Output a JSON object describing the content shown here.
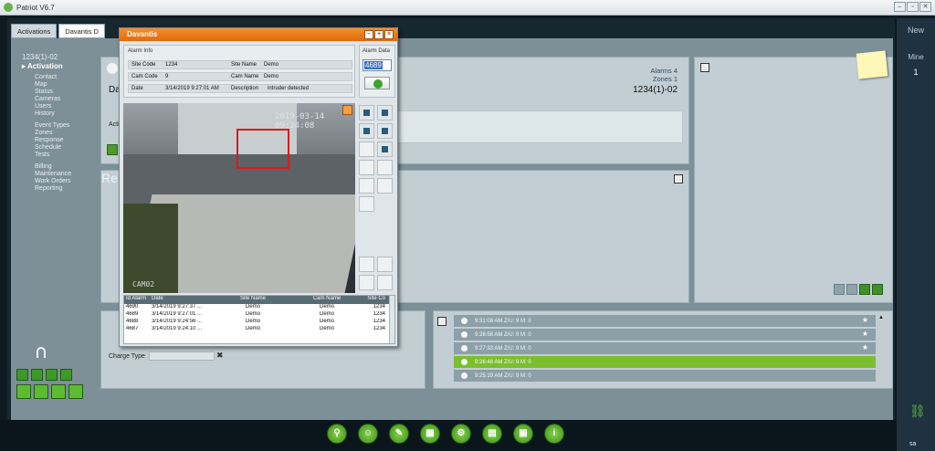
{
  "app": {
    "title": "Patriot V6.7"
  },
  "tabs": [
    {
      "label": "Activations"
    },
    {
      "label": "Davantis D"
    }
  ],
  "nav": {
    "code": "1234(1)-02",
    "active": "Activation",
    "items": [
      "Contact",
      "Map",
      "Status",
      "Cameras",
      "Users",
      "History"
    ],
    "items2": [
      "Event Types",
      "Zones",
      "Response",
      "Schedule",
      "Tests"
    ],
    "items3": [
      "Billing",
      "Maintenance",
      "Work Orders",
      "Reporting"
    ]
  },
  "main": {
    "client_prefix": "Da",
    "client_code": "1234(1)-02",
    "alarms": "Alarms  4",
    "zones": "Zones  1",
    "activity_prefix": "Activ",
    "reports_prefix": "Re",
    "charge_type_label": "Charge Type",
    "charge_x": "✖"
  },
  "events": [
    {
      "text": "9:31:08 AM Z/U: 9 M: 0",
      "star": true,
      "highlight": false
    },
    {
      "text": "9:28:58 AM Z/U: 9 M: 0",
      "star": true,
      "highlight": false
    },
    {
      "text": "9:27:33 AM Z/U: 9 M: 0",
      "star": true,
      "highlight": false
    },
    {
      "text": "9:26:48 AM Z/U: 9 M: 0",
      "star": false,
      "highlight": true
    },
    {
      "text": "9:25:19 AM Z/U: 9 M: 0",
      "star": false,
      "highlight": false
    }
  ],
  "dialog": {
    "title": "Davantis",
    "alarm_info_caption": "Alarm Info",
    "alarm_data_caption": "Alarm Data",
    "site_code_label": "Site Code",
    "site_code": "1234",
    "site_name_label": "Site Name",
    "site_name": "Demo",
    "cam_code_label": "Cam Code",
    "cam_code": "9",
    "cam_name_label": "Cam Name",
    "cam_name": "Demo",
    "date_label": "Date",
    "date": "3/14/2019 9:27:01 AM",
    "description_label": "Description",
    "description": "intruder detected",
    "alarm_data_value": "4689",
    "video_timestamp": "2019-03-14 09:24:08",
    "video_cam": "CAM02",
    "table": {
      "headers": [
        "Id Alarm",
        "Date",
        "Site Name",
        "Cam Name",
        "Site Co"
      ],
      "rows": [
        [
          "4690",
          "3/14/2019 9:27:37 ...",
          "Demo",
          "Demo",
          "1234"
        ],
        [
          "4689",
          "3/14/2019 9:27:01 ...",
          "Demo",
          "Demo",
          "1234"
        ],
        [
          "4688",
          "3/14/2019 9:24:56 ...",
          "Demo",
          "Demo",
          "1234"
        ],
        [
          "4687",
          "3/14/2019 9:24:10 ...",
          "Demo",
          "Demo",
          "1234"
        ]
      ]
    }
  },
  "right_strip": {
    "new_label": "New",
    "mine_label": "Mine",
    "mine_count": "1",
    "user": "sa"
  },
  "colors": {
    "accent_orange": "#e06a10",
    "accent_green": "#3d9a28",
    "highlight_green": "#7cbf2e"
  },
  "icons": [
    "chain-link-icon",
    "close-icon",
    "star-icon",
    "collapse-icon",
    "checkmark-icon",
    "lock-icon",
    "zoom-icon"
  ]
}
